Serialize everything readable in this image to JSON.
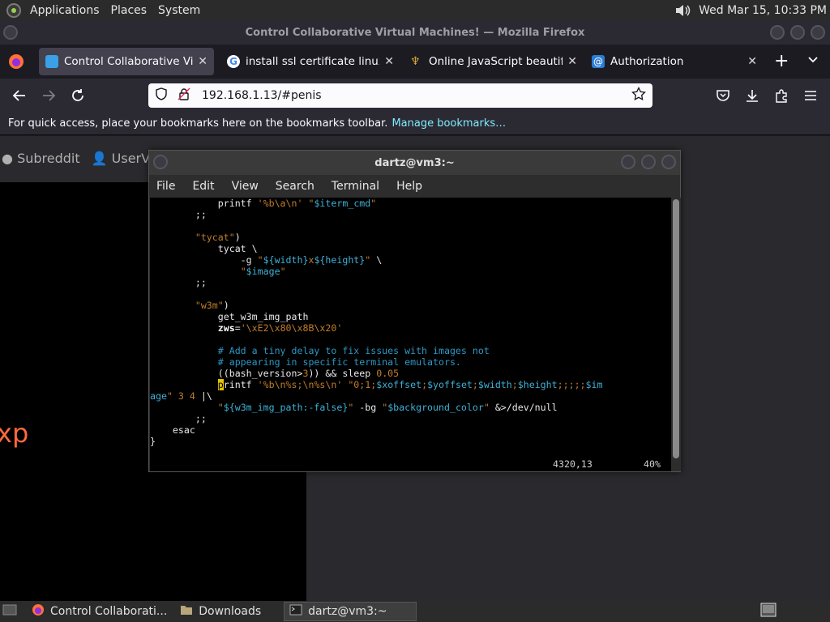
{
  "top_panel": {
    "menus": [
      "Applications",
      "Places",
      "System"
    ],
    "clock": "Wed Mar 15, 10:33 PM"
  },
  "firefox": {
    "window_title": "Control Collaborative Virtual Machines! — Mozilla Firefox",
    "tabs": [
      {
        "title": "Control Collaborative Virtua",
        "active": true
      },
      {
        "title": "install ssl certificate linux - G",
        "active": false
      },
      {
        "title": "Online JavaScript beautifier",
        "active": false
      },
      {
        "title": "Authorization",
        "active": false
      }
    ],
    "url": "192.168.1.13/#penis",
    "bookmarks": {
      "message": "For quick access, place your bookmarks here on the bookmarks toolbar.",
      "link": "Manage bookmarks…"
    }
  },
  "page": {
    "nav_links": [
      "Subreddit",
      "UserVM"
    ],
    "partial_text": "xp"
  },
  "terminal": {
    "title": "dartz@vm3:~",
    "menus": [
      "File",
      "Edit",
      "View",
      "Search",
      "Terminal",
      "Help"
    ],
    "status_position": "4320,13",
    "status_percent": "40%"
  },
  "taskbar": {
    "items": [
      "Control Collaborati...",
      "Downloads",
      "dartz@vm3:~"
    ]
  },
  "colors": {
    "string": "#c17d2b",
    "variable": "#3fb0d6",
    "comment": "#2e96c4",
    "cursor": "#e5c400",
    "link": "#80ebff"
  }
}
